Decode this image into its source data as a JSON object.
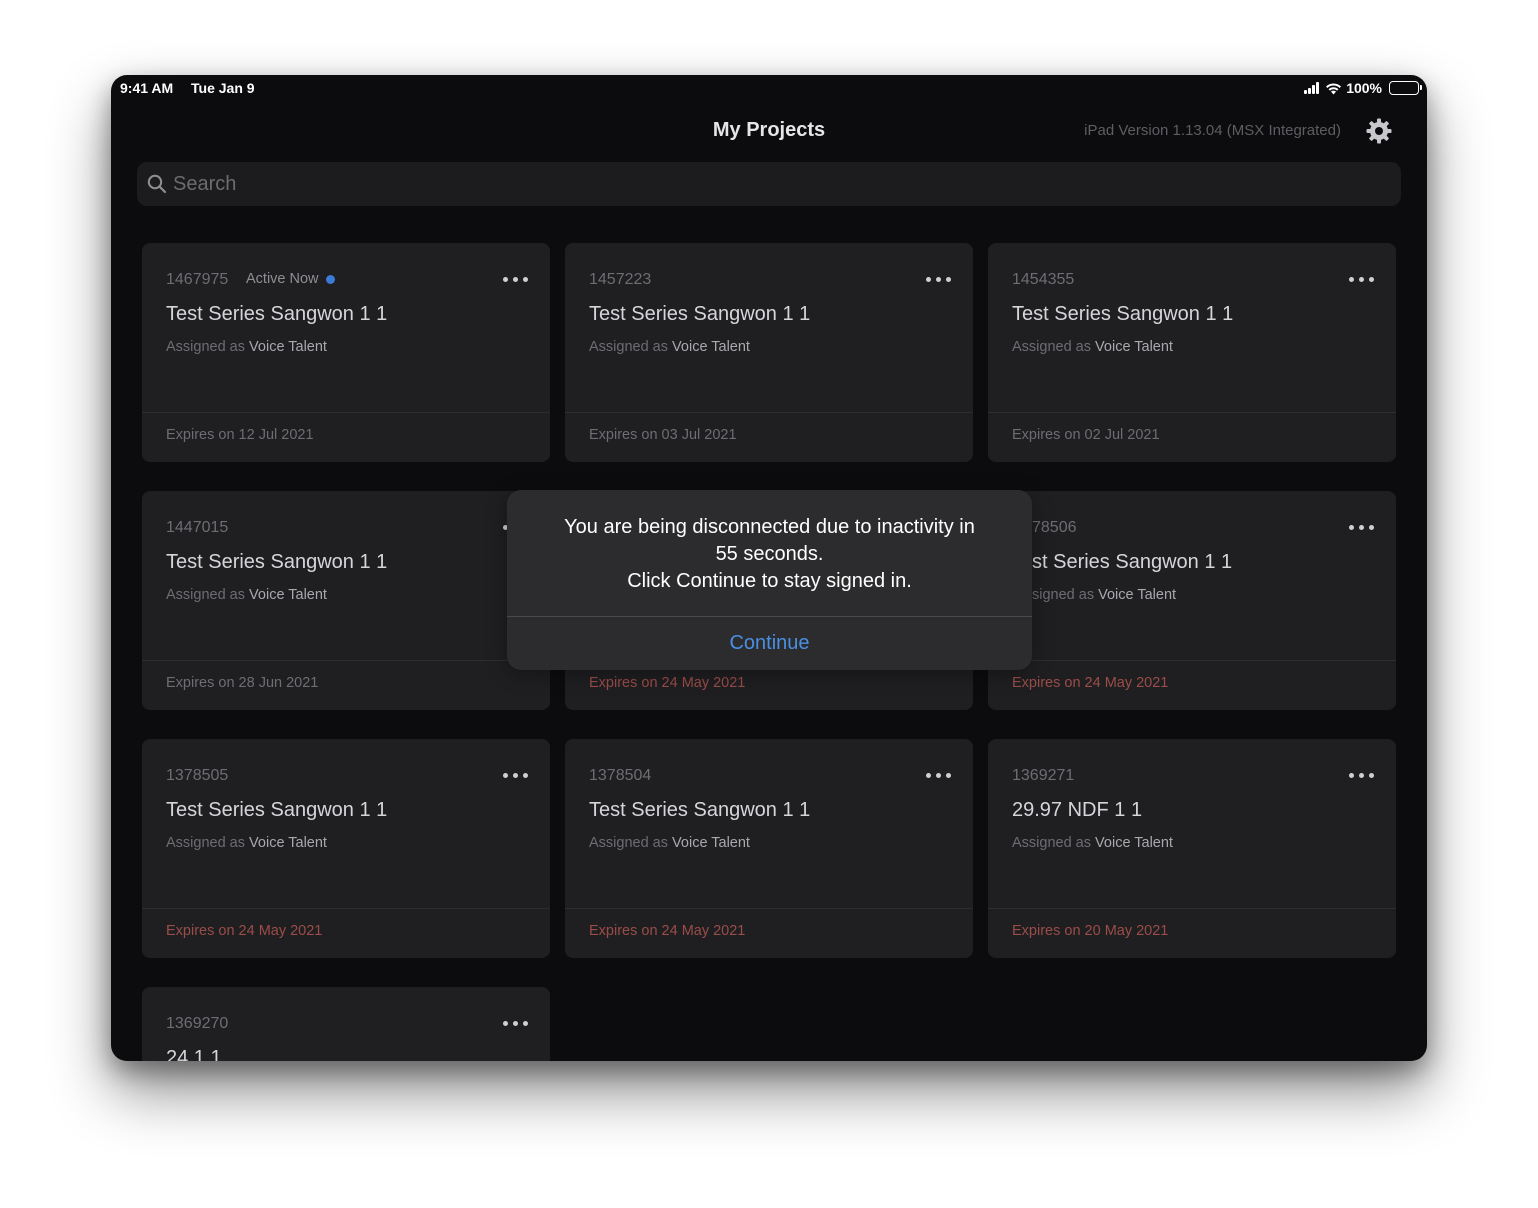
{
  "status_bar": {
    "time": "9:41 AM",
    "date": "Tue Jan 9",
    "battery": "100%"
  },
  "header": {
    "title": "My Projects",
    "version": "iPad Version 1.13.04 (MSX Integrated)",
    "settings_icon": "gear-icon"
  },
  "search": {
    "placeholder": "Search",
    "value": ""
  },
  "cards": [
    {
      "id": "1467975",
      "active_label": "Active Now",
      "title": "Test Series Sangwon 1 1",
      "assigned_prefix": "Assigned as",
      "role": "Voice Talent",
      "expiry": "Expires on 12 Jul 2021",
      "expired": false
    },
    {
      "id": "1457223",
      "title": "Test Series Sangwon 1 1",
      "assigned_prefix": "Assigned as",
      "role": "Voice Talent",
      "expiry": "Expires on 03 Jul 2021",
      "expired": false
    },
    {
      "id": "1454355",
      "title": "Test Series Sangwon 1 1",
      "assigned_prefix": "Assigned as",
      "role": "Voice Talent",
      "expiry": "Expires on 02 Jul 2021",
      "expired": false
    },
    {
      "id": "1447015",
      "title": "Test Series Sangwon 1 1",
      "assigned_prefix": "Assigned as",
      "role": "Voice Talent",
      "expiry": "Expires on 28 Jun 2021",
      "expired": false
    },
    {
      "id": "",
      "title": "",
      "assigned_prefix": "",
      "role": "",
      "expiry": "Expires on 24 May 2021",
      "expired": true
    },
    {
      "id": "78506",
      "title": "st Series Sangwon 1 1",
      "assigned_prefix": "signed as",
      "role": "Voice Talent",
      "expiry": "Expires on 24 May 2021",
      "expired": true
    },
    {
      "id": "1378505",
      "title": "Test Series Sangwon 1 1",
      "assigned_prefix": "Assigned as",
      "role": "Voice Talent",
      "expiry": "Expires on 24 May 2021",
      "expired": true
    },
    {
      "id": "1378504",
      "title": "Test Series Sangwon 1 1",
      "assigned_prefix": "Assigned as",
      "role": "Voice Talent",
      "expiry": "Expires on 24 May 2021",
      "expired": true
    },
    {
      "id": "1369271",
      "title": "29.97 NDF 1 1",
      "assigned_prefix": "Assigned as",
      "role": "Voice Talent",
      "expiry": "Expires on 20 May 2021",
      "expired": true
    },
    {
      "id": "1369270",
      "title": "24 1 1",
      "assigned_prefix": "",
      "role": "",
      "expiry": "",
      "expired": false
    }
  ],
  "alert": {
    "line1": "You are being disconnected due to inactivity in",
    "line2": "55 seconds.",
    "line3": "Click Continue to stay signed in.",
    "button_label": "Continue"
  },
  "colors": {
    "background": "#0c0c0e",
    "card": "#1f1f22",
    "accent": "#4a90e2",
    "active_dot": "#3a7bd5",
    "expired_text": "#9a4d47"
  }
}
